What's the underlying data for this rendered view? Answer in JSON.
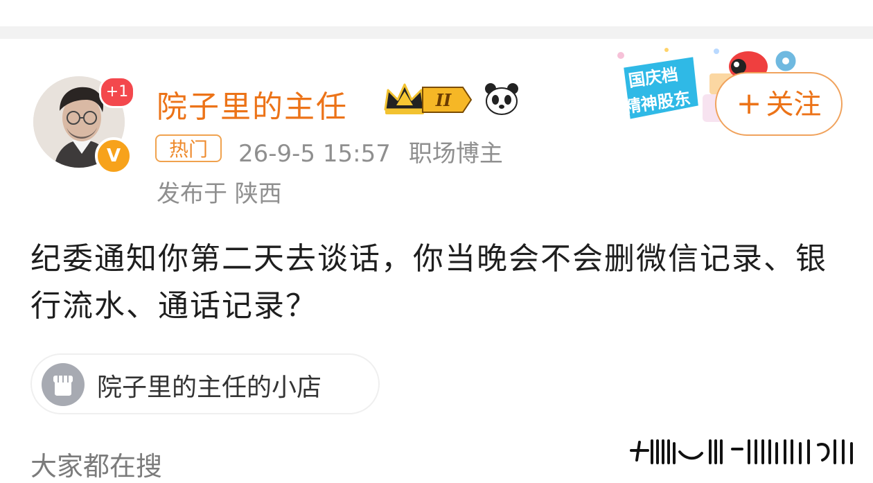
{
  "post": {
    "author": {
      "name": "院子里的主任",
      "new_count_badge": "+1",
      "verified_badge": "V",
      "level_badge": "II"
    },
    "hot_tag": "热门",
    "timestamp": "26-9-5 15:57",
    "role": "职场博主",
    "location": "发布于 陕西",
    "content": "纪委通知你第二天去谈话，你当晚会不会删微信记录、银行流水、通话记录？",
    "shop_link": "院子里的主任的小店"
  },
  "follow_button": {
    "label": "关注",
    "icon": "+"
  },
  "promo_banner": {
    "line1": "国庆档",
    "line2": "精神股东"
  },
  "section": {
    "everyone_searching": "大家都在搜"
  },
  "colors": {
    "accent": "#ec7318",
    "hot_border": "#f0a24e",
    "badge_red": "#f3484d",
    "vip_gold": "#f7a21b",
    "meta_gray": "#8f8f8f"
  },
  "icons": [
    "avatar",
    "crown-level-icon",
    "panda-icon",
    "shop-icon",
    "plus-icon"
  ]
}
